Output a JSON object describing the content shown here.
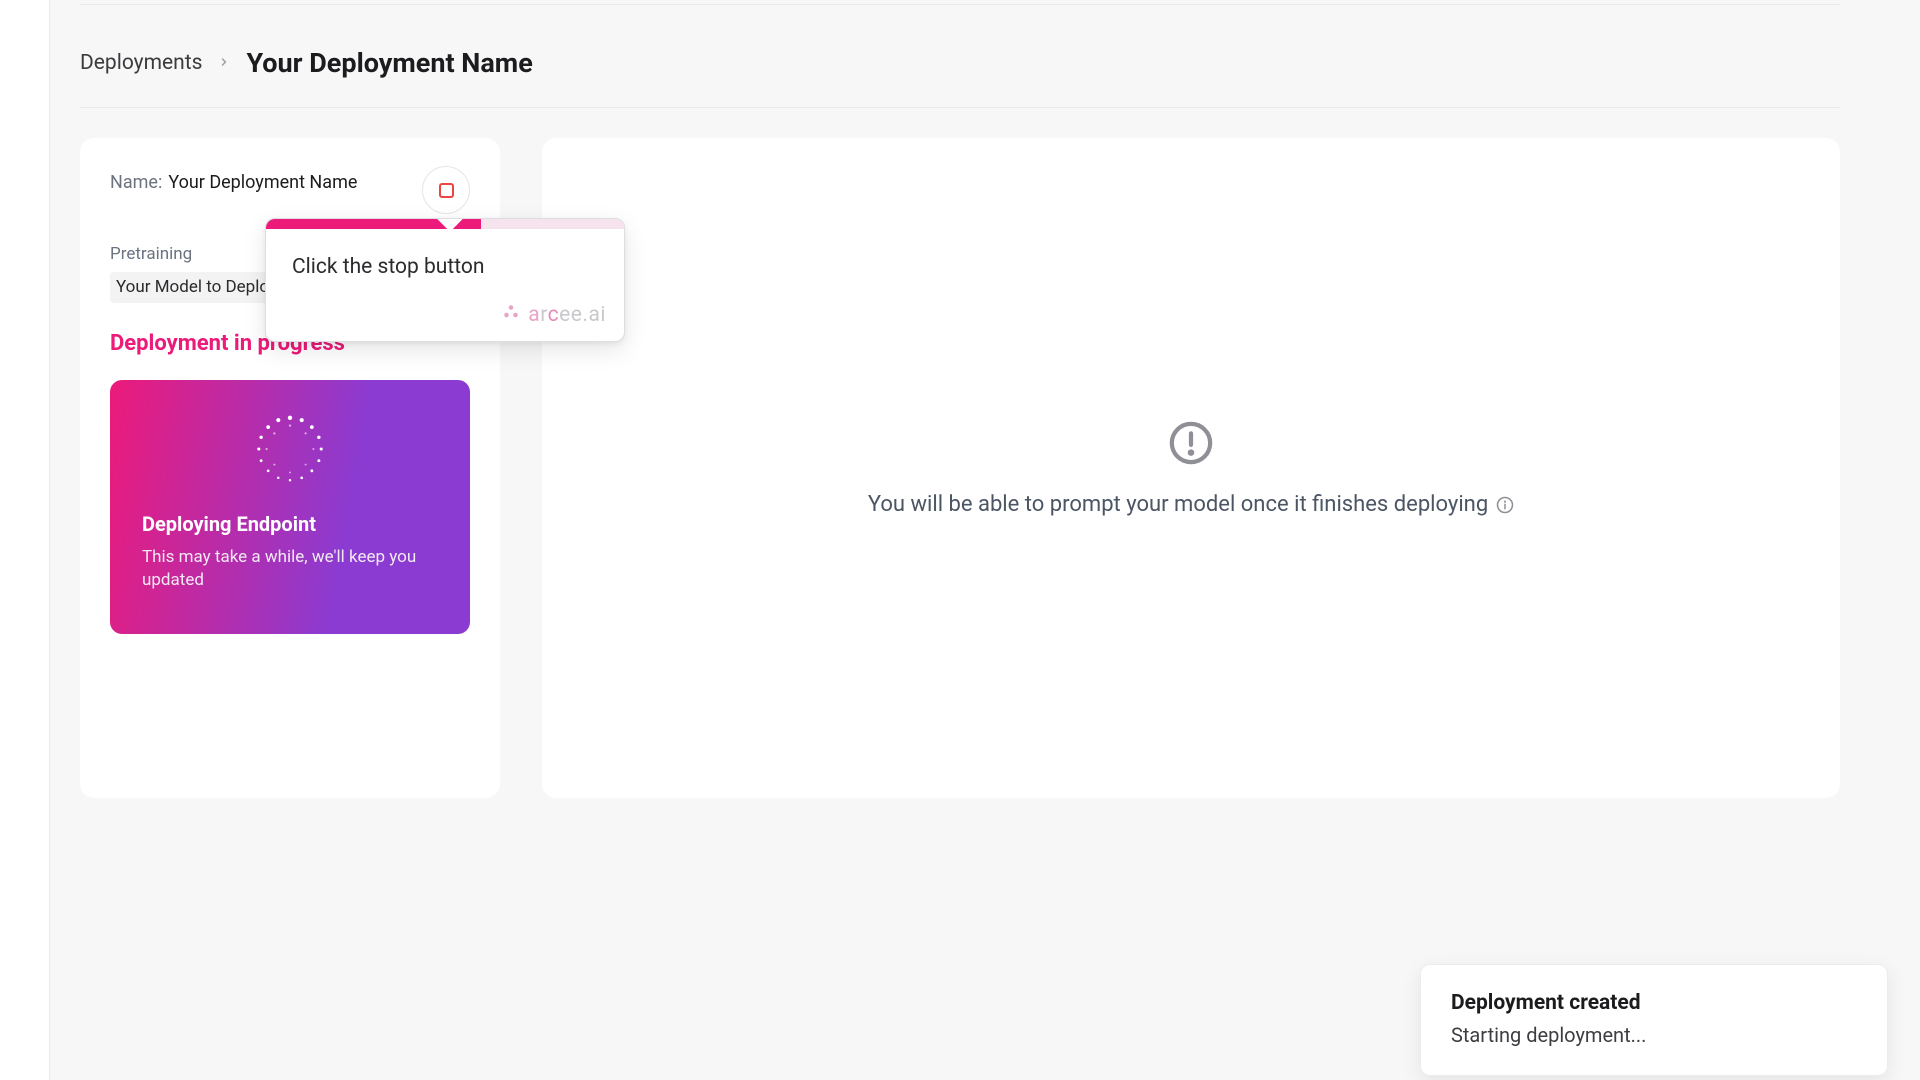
{
  "breadcrumb": {
    "root": "Deployments",
    "current": "Your Deployment Name"
  },
  "details": {
    "name_label": "Name:",
    "name_value": "Your Deployment Name",
    "section_label": "Pretraining",
    "model_chip": "Your Model to Deploy",
    "status_heading": "Deployment in progress"
  },
  "deploy_card": {
    "title": "Deploying Endpoint",
    "subtitle": "This may take a while, we'll keep you updated"
  },
  "popover": {
    "text": "Click the stop button",
    "brand": "arcee.ai",
    "progress_percent": 60
  },
  "right_panel": {
    "message": "You will be able to prompt your model once it finishes deploying"
  },
  "toast": {
    "title": "Deployment created",
    "body": "Starting deployment..."
  },
  "colors": {
    "accent_pink": "#ec1a7a",
    "accent_purple": "#8b3bd1",
    "stop_red": "#ef4444"
  }
}
